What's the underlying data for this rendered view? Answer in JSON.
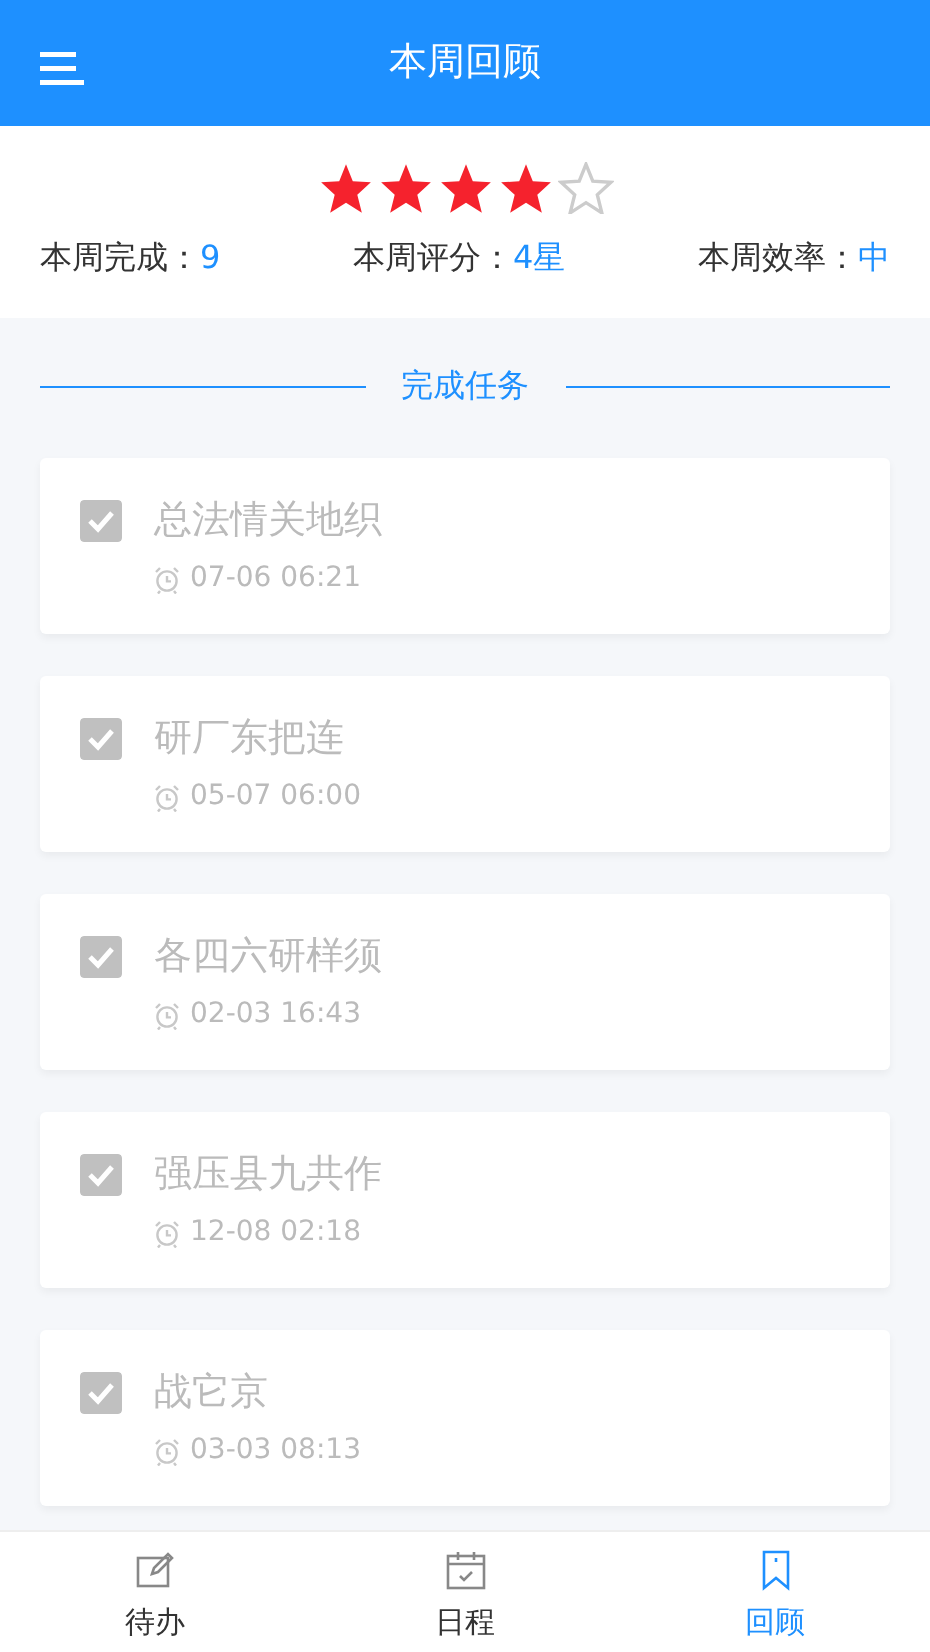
{
  "header": {
    "title": "本周回顾"
  },
  "rating": {
    "stars": 4
  },
  "stats": [
    {
      "label": "本周完成：",
      "value": "9"
    },
    {
      "label": "本周评分：",
      "value": "4星"
    },
    {
      "label": "本周效率：",
      "value": "中"
    }
  ],
  "section_title": "完成任务",
  "tasks": [
    {
      "title": "总法情关地织",
      "time": "07-06 06:21",
      "checked": true
    },
    {
      "title": "研厂东把连",
      "time": "05-07 06:00",
      "checked": true
    },
    {
      "title": "各四六研样须",
      "time": "02-03 16:43",
      "checked": true
    },
    {
      "title": "强压县九共作",
      "time": "12-08 02:18",
      "checked": true
    },
    {
      "title": "战它京",
      "time": "03-03 08:13",
      "checked": true
    }
  ],
  "tabbar": [
    {
      "label": "待办",
      "kind": "todo",
      "selected": false
    },
    {
      "label": "日程",
      "kind": "calendar",
      "selected": false
    },
    {
      "label": "回顾",
      "kind": "review",
      "selected": true
    }
  ]
}
